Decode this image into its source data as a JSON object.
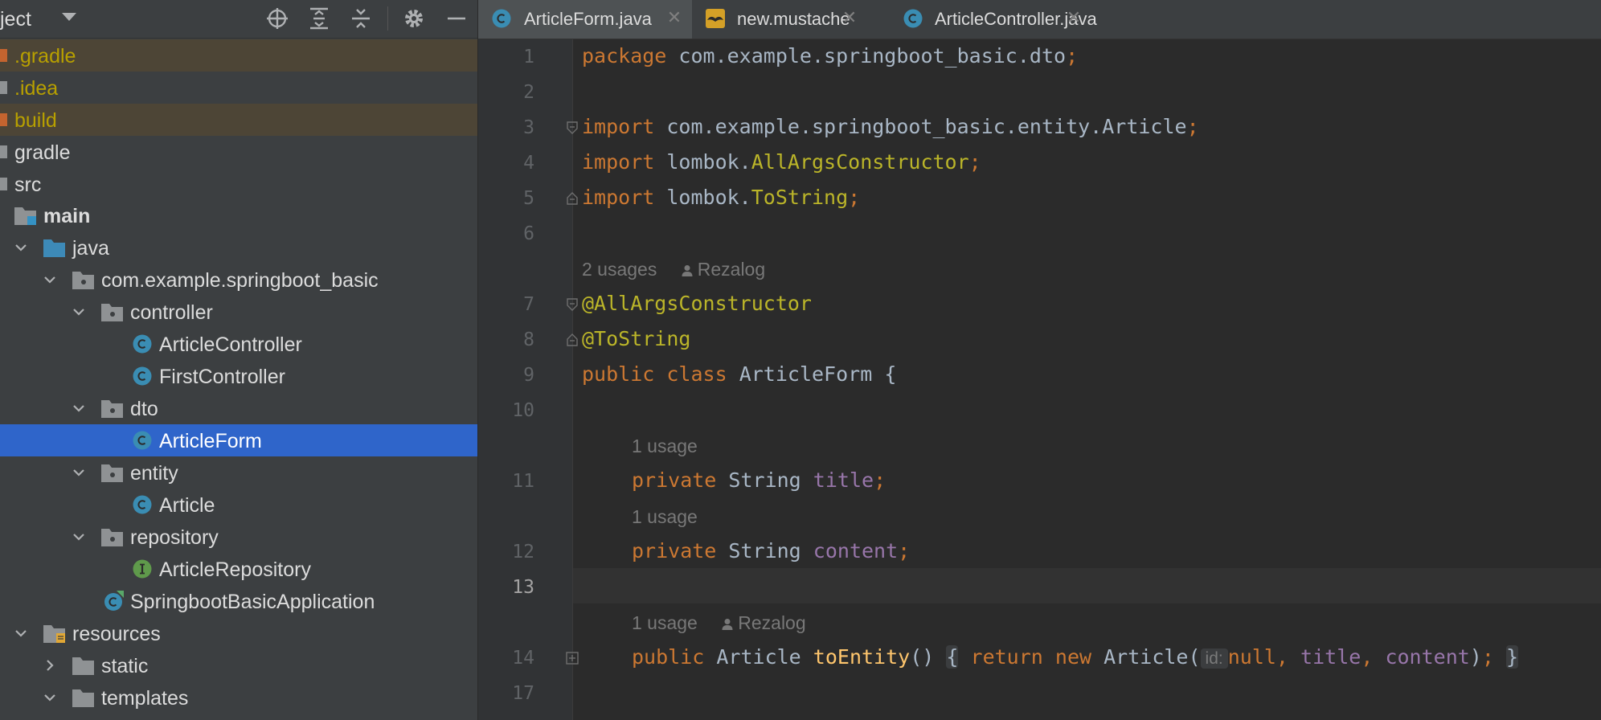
{
  "sidebar": {
    "title": "ject",
    "toolbar": {
      "locate": "crosshair-icon",
      "expand_all": "expand-all-icon",
      "collapse_all": "collapse-all-icon",
      "settings": "gear-icon",
      "hide": "minimize-icon"
    },
    "tree": [
      {
        "label": ".gradle",
        "type": "folder-excluded"
      },
      {
        "label": ".idea",
        "type": "folder-plain"
      },
      {
        "label": "build",
        "type": "folder-excluded"
      },
      {
        "label": "gradle",
        "type": "folder-plain"
      },
      {
        "label": "src",
        "type": "folder-plain"
      },
      {
        "label": "main",
        "type": "module"
      },
      {
        "label": "java",
        "type": "source-root"
      },
      {
        "label": "com.example.springboot_basic",
        "type": "package"
      },
      {
        "label": "controller",
        "type": "package"
      },
      {
        "label": "ArticleController",
        "type": "class"
      },
      {
        "label": "FirstController",
        "type": "class"
      },
      {
        "label": "dto",
        "type": "package"
      },
      {
        "label": "ArticleForm",
        "type": "class",
        "selected": true
      },
      {
        "label": "entity",
        "type": "package"
      },
      {
        "label": "Article",
        "type": "class"
      },
      {
        "label": "repository",
        "type": "package"
      },
      {
        "label": "ArticleRepository",
        "type": "interface"
      },
      {
        "label": "SpringbootBasicApplication",
        "type": "spring-boot-class"
      },
      {
        "label": "resources",
        "type": "resources-root"
      },
      {
        "label": "static",
        "type": "folder"
      },
      {
        "label": "templates",
        "type": "folder"
      }
    ]
  },
  "tabs": [
    {
      "label": "ArticleForm.java",
      "icon": "java-class-icon",
      "active": true
    },
    {
      "label": "new.mustache",
      "icon": "mustache-icon",
      "active": false
    },
    {
      "label": "ArticleController.java",
      "icon": "java-class-icon",
      "active": false
    }
  ],
  "editor": {
    "current_line": "13",
    "line_numbers": [
      "1",
      "2",
      "3",
      "4",
      "5",
      "6",
      "7",
      "8",
      "9",
      "10",
      "11",
      "12",
      "13",
      "14",
      "17"
    ],
    "code": {
      "l1": {
        "kw": "package",
        "pkg": "com.example.springboot_basic.dto",
        "semi": ";"
      },
      "l3": {
        "kw": "import",
        "path": "com.example.springboot_basic.entity.Article",
        "semi": ";"
      },
      "l4": {
        "kw": "import",
        "path": "lombok.",
        "cls": "AllArgsConstructor",
        "semi": ";"
      },
      "l5": {
        "kw": "import",
        "path": "lombok.",
        "cls": "ToString",
        "semi": ";"
      },
      "l7": {
        "ann": "@AllArgsConstructor"
      },
      "l8": {
        "ann": "@ToString"
      },
      "l9": {
        "kw1": "public",
        "kw2": "class",
        "name": "ArticleForm",
        "brace": "{"
      },
      "l11": {
        "kw": "private",
        "type": "String",
        "field": "title",
        "semi": ";"
      },
      "l12": {
        "kw": "private",
        "type": "String",
        "field": "content",
        "semi": ";"
      },
      "l14": {
        "kw": "public",
        "type": "Article",
        "method": "toEntity",
        "parens": "()",
        "open": "{",
        "ret": "return",
        "new": "new",
        "ctor": "Article(",
        "param_hint": "id:",
        "null_kw": "null,",
        "arg1": "title",
        "comma": ",",
        "arg2": "content",
        "close_paren": ")",
        "semi": ";",
        "close": "}"
      }
    },
    "hints": {
      "class_usages": "2 usages",
      "class_author": "Rezalog",
      "title_usages": "1 usage",
      "content_usages": "1 usage",
      "method_usages": "1 usage",
      "method_author": "Rezalog",
      "author_icon": "person-icon"
    }
  },
  "colors": {
    "keyword": "#cc7832",
    "annotation": "#bbb529",
    "field": "#9876aa",
    "method": "#ffc66d",
    "text": "#a9b7c6",
    "selection": "#2f65ca",
    "excluded_folder": "#b8a000"
  }
}
